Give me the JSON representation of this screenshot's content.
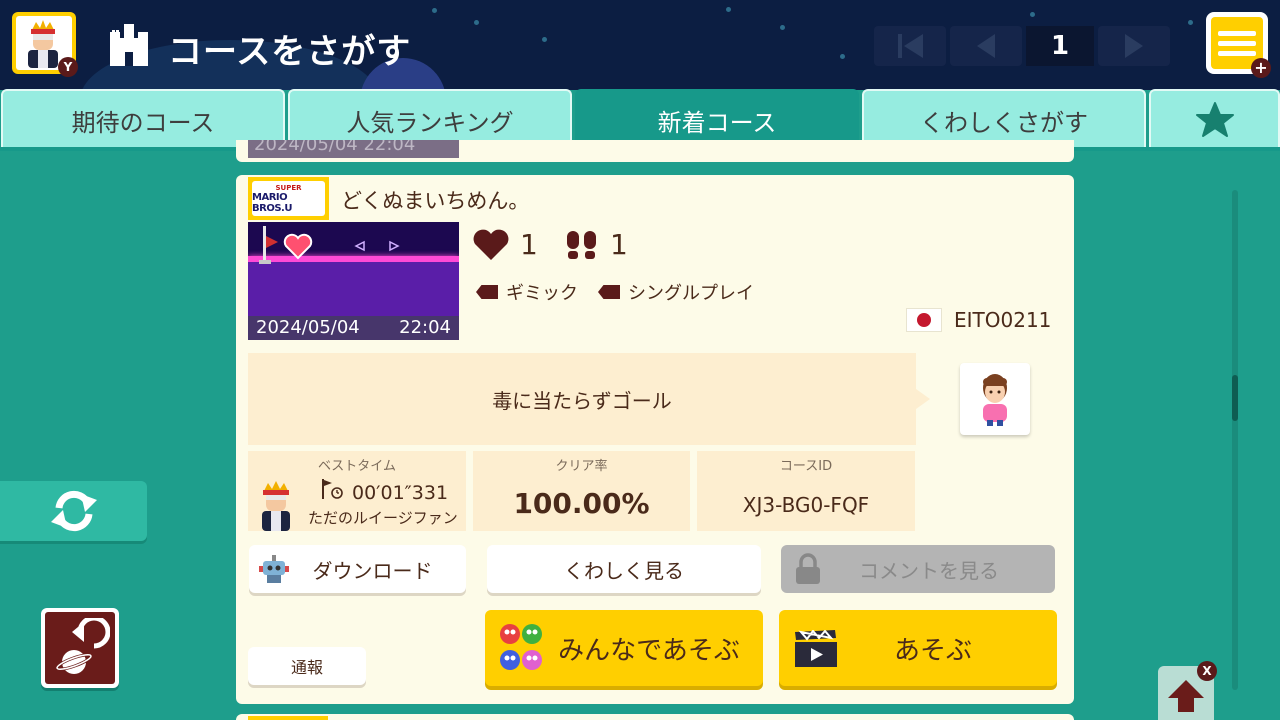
{
  "header": {
    "title": "コースをさがす",
    "page_number": "1",
    "avatar_badge": "Y",
    "menu_badge": "+"
  },
  "tabs": [
    {
      "label": "期待のコース",
      "active": false
    },
    {
      "label": "人気ランキング",
      "active": false
    },
    {
      "label": "新着コース",
      "active": true
    },
    {
      "label": "くわしくさがす",
      "active": false
    },
    {
      "label": "",
      "icon": "star-icon",
      "active": false
    }
  ],
  "prev_card": {
    "date": "2024/05/04    22:04"
  },
  "course": {
    "game_logo_top": "SUPER",
    "game_logo_bottom": "MARIO BROS.U",
    "name": "どくぬまいちめん。",
    "date": "2024/05/04",
    "time": "22:04",
    "likes": "1",
    "plays": "1",
    "tags": [
      "ギミック",
      "シングルプレイ"
    ],
    "maker": "EITO0211",
    "description": "毒に当たらずゴール",
    "best_time_label": "ベストタイム",
    "best_time": "00′01″331",
    "best_time_player": "ただのルイージファン",
    "clear_rate_label": "クリア率",
    "clear_rate": "100.00%",
    "course_id_label": "コースID",
    "course_id": "XJ3-BG0-FQF"
  },
  "buttons": {
    "download": "ダウンロード",
    "details": "くわしく見る",
    "comments": "コメントを見る",
    "report": "通報",
    "multiplayer": "みんなであそぶ",
    "play": "あそぶ"
  },
  "top_button_badge": "X",
  "colors": {
    "header_bg": "#0c1e42",
    "background": "#1e9e8c",
    "tab_inactive": "#96ece0",
    "tab_active": "#17998a",
    "card_bg": "#fdfbe8",
    "accent_yellow": "#ffcf00",
    "text_brown": "#4a2a1a"
  }
}
